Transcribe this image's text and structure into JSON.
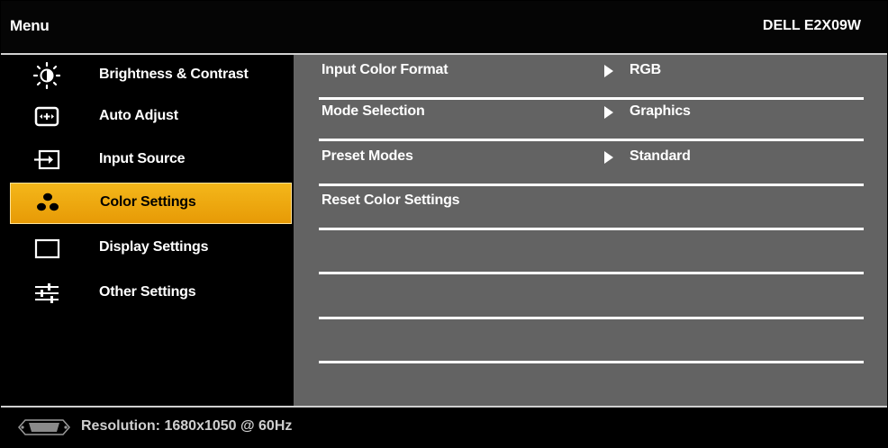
{
  "header": {
    "menu_title": "Menu",
    "model": "DELL E2X09W"
  },
  "sidebar": {
    "items": [
      {
        "label": "Brightness & Contrast",
        "icon": "brightness-icon",
        "selected": false
      },
      {
        "label": "Auto Adjust",
        "icon": "auto-adjust-icon",
        "selected": false
      },
      {
        "label": "Input Source",
        "icon": "input-source-icon",
        "selected": false
      },
      {
        "label": "Color Settings",
        "icon": "color-settings-icon",
        "selected": true
      },
      {
        "label": "Display Settings",
        "icon": "display-settings-icon",
        "selected": false
      },
      {
        "label": "Other Settings",
        "icon": "other-settings-icon",
        "selected": false
      }
    ]
  },
  "content": {
    "rows": [
      {
        "label": "Input Color Format",
        "value": "RGB"
      },
      {
        "label": "Mode Selection",
        "value": "Graphics"
      },
      {
        "label": "Preset Modes",
        "value": "Standard"
      },
      {
        "label": "Reset Color Settings",
        "value": ""
      },
      {
        "label": "",
        "value": ""
      },
      {
        "label": "",
        "value": ""
      },
      {
        "label": "",
        "value": ""
      }
    ]
  },
  "status": {
    "resolution": "Resolution: 1680x1050 @ 60Hz",
    "icon": "vga-connector-icon"
  },
  "colors": {
    "background": "#000000",
    "content_panel": "#636363",
    "selected_gradient_top": "#f4b71a",
    "selected_gradient_bottom": "#e79a06",
    "text": "#ffffff"
  }
}
